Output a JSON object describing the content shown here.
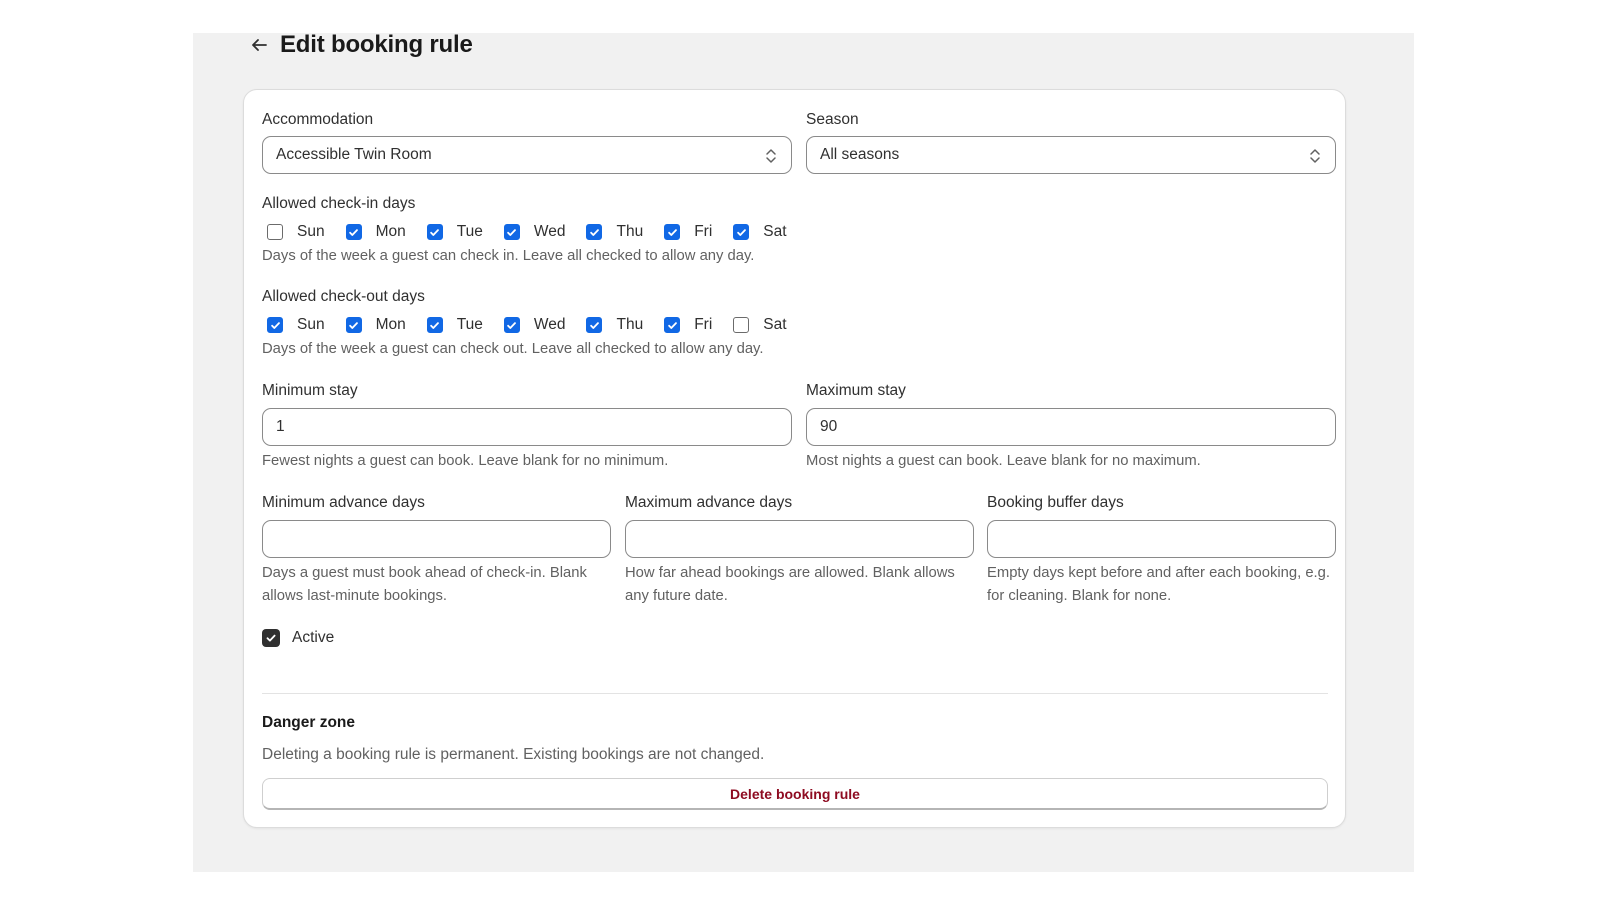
{
  "page": {
    "title": "Edit booking rule",
    "back_icon": "arrow-left-icon"
  },
  "accommodation": {
    "label": "Accommodation",
    "value": "Accessible Twin Room"
  },
  "season": {
    "label": "Season",
    "value": "All seasons"
  },
  "checkin": {
    "label": "Allowed check-in days",
    "help": "Days of the week a guest can check in. Leave all checked to allow any day.",
    "days": [
      {
        "label": "Sun",
        "checked": false
      },
      {
        "label": "Mon",
        "checked": true
      },
      {
        "label": "Tue",
        "checked": true
      },
      {
        "label": "Wed",
        "checked": true
      },
      {
        "label": "Thu",
        "checked": true
      },
      {
        "label": "Fri",
        "checked": true
      },
      {
        "label": "Sat",
        "checked": true
      }
    ]
  },
  "checkout": {
    "label": "Allowed check-out days",
    "help": "Days of the week a guest can check out. Leave all checked to allow any day.",
    "days": [
      {
        "label": "Sun",
        "checked": true
      },
      {
        "label": "Mon",
        "checked": true
      },
      {
        "label": "Tue",
        "checked": true
      },
      {
        "label": "Wed",
        "checked": true
      },
      {
        "label": "Thu",
        "checked": true
      },
      {
        "label": "Fri",
        "checked": true
      },
      {
        "label": "Sat",
        "checked": false
      }
    ]
  },
  "min_stay": {
    "label": "Minimum stay",
    "value": "1",
    "help": "Fewest nights a guest can book. Leave blank for no minimum."
  },
  "max_stay": {
    "label": "Maximum stay",
    "value": "90",
    "help": "Most nights a guest can book. Leave blank for no maximum."
  },
  "min_advance": {
    "label": "Minimum advance days",
    "value": "",
    "help": "Days a guest must book ahead of check-in. Blank allows last-minute bookings."
  },
  "max_advance": {
    "label": "Maximum advance days",
    "value": "",
    "help": "How far ahead bookings are allowed. Blank allows any future date."
  },
  "buffer": {
    "label": "Booking buffer days",
    "value": "",
    "help": "Empty days kept before and after each booking, e.g. for cleaning. Blank for none."
  },
  "active": {
    "label": "Active",
    "checked": true
  },
  "danger": {
    "title": "Danger zone",
    "text": "Deleting a booking rule is permanent. Existing bookings are not changed.",
    "button": "Delete booking rule"
  },
  "colors": {
    "accent": "#1168e5",
    "danger": "#8e0b21",
    "background": "#f1f1f1"
  }
}
